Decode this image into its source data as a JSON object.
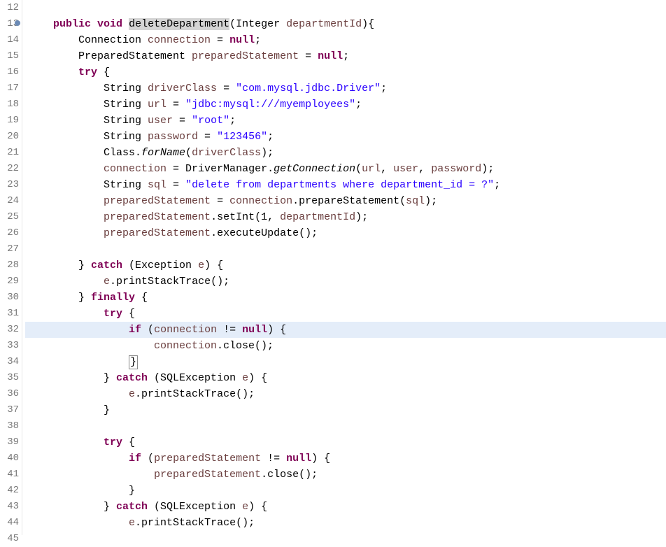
{
  "gutter": {
    "start": 12,
    "end": 45,
    "marker_line": 13
  },
  "code": {
    "highlight_line": 32,
    "lines": [
      {
        "n": 12,
        "tokens": [
          [
            "    ",
            ""
          ]
        ]
      },
      {
        "n": 13,
        "tokens": [
          [
            "    ",
            ""
          ],
          [
            "public",
            "kw"
          ],
          [
            " ",
            ""
          ],
          [
            "void",
            "kw"
          ],
          [
            " ",
            ""
          ],
          [
            "deleteDepartment",
            "sel-occ"
          ],
          [
            "(Integer ",
            ""
          ],
          [
            "departmentId",
            "var"
          ],
          [
            "){",
            ""
          ]
        ]
      },
      {
        "n": 14,
        "tokens": [
          [
            "        Connection ",
            ""
          ],
          [
            "connection",
            "var"
          ],
          [
            " = ",
            ""
          ],
          [
            "null",
            "kw"
          ],
          [
            ";",
            ""
          ]
        ]
      },
      {
        "n": 15,
        "tokens": [
          [
            "        PreparedStatement ",
            ""
          ],
          [
            "preparedStatement",
            "var"
          ],
          [
            " = ",
            ""
          ],
          [
            "null",
            "kw"
          ],
          [
            ";",
            ""
          ]
        ]
      },
      {
        "n": 16,
        "tokens": [
          [
            "        ",
            ""
          ],
          [
            "try",
            "kw"
          ],
          [
            " {",
            ""
          ]
        ]
      },
      {
        "n": 17,
        "tokens": [
          [
            "            String ",
            ""
          ],
          [
            "driverClass",
            "var"
          ],
          [
            " = ",
            ""
          ],
          [
            "\"com.mysql.jdbc.Driver\"",
            "str"
          ],
          [
            ";",
            ""
          ]
        ]
      },
      {
        "n": 18,
        "tokens": [
          [
            "            String ",
            ""
          ],
          [
            "url",
            "var"
          ],
          [
            " = ",
            ""
          ],
          [
            "\"jdbc:mysql:///myemployees\"",
            "str"
          ],
          [
            ";",
            ""
          ]
        ]
      },
      {
        "n": 19,
        "tokens": [
          [
            "            String ",
            ""
          ],
          [
            "user",
            "var"
          ],
          [
            " = ",
            ""
          ],
          [
            "\"root\"",
            "str"
          ],
          [
            ";",
            ""
          ]
        ]
      },
      {
        "n": 20,
        "tokens": [
          [
            "            String ",
            ""
          ],
          [
            "password",
            "var"
          ],
          [
            " = ",
            ""
          ],
          [
            "\"123456\"",
            "str"
          ],
          [
            ";",
            ""
          ]
        ]
      },
      {
        "n": 21,
        "tokens": [
          [
            "            Class.",
            ""
          ],
          [
            "forName",
            "mtd"
          ],
          [
            "(",
            ""
          ],
          [
            "driverClass",
            "var"
          ],
          [
            ");",
            ""
          ]
        ]
      },
      {
        "n": 22,
        "tokens": [
          [
            "            ",
            ""
          ],
          [
            "connection",
            "var"
          ],
          [
            " = DriverManager.",
            ""
          ],
          [
            "getConnection",
            "mtd"
          ],
          [
            "(",
            ""
          ],
          [
            "url",
            "var"
          ],
          [
            ", ",
            ""
          ],
          [
            "user",
            "var"
          ],
          [
            ", ",
            ""
          ],
          [
            "password",
            "var"
          ],
          [
            ");",
            ""
          ]
        ]
      },
      {
        "n": 23,
        "tokens": [
          [
            "            String ",
            ""
          ],
          [
            "sql",
            "var"
          ],
          [
            " = ",
            ""
          ],
          [
            "\"delete from departments where department_id = ?\"",
            "str"
          ],
          [
            ";",
            ""
          ]
        ]
      },
      {
        "n": 24,
        "tokens": [
          [
            "            ",
            ""
          ],
          [
            "preparedStatement",
            "var"
          ],
          [
            " = ",
            ""
          ],
          [
            "connection",
            "var"
          ],
          [
            ".prepareStatement(",
            ""
          ],
          [
            "sql",
            "var"
          ],
          [
            ");",
            ""
          ]
        ]
      },
      {
        "n": 25,
        "tokens": [
          [
            "            ",
            ""
          ],
          [
            "preparedStatement",
            "var"
          ],
          [
            ".setInt(1, ",
            ""
          ],
          [
            "departmentId",
            "var"
          ],
          [
            ");",
            ""
          ]
        ]
      },
      {
        "n": 26,
        "tokens": [
          [
            "            ",
            ""
          ],
          [
            "preparedStatement",
            "var"
          ],
          [
            ".executeUpdate();",
            ""
          ]
        ]
      },
      {
        "n": 27,
        "tokens": [
          [
            "",
            ""
          ]
        ]
      },
      {
        "n": 28,
        "tokens": [
          [
            "        } ",
            ""
          ],
          [
            "catch",
            "kw"
          ],
          [
            " (Exception ",
            ""
          ],
          [
            "e",
            "var"
          ],
          [
            ") {",
            ""
          ]
        ]
      },
      {
        "n": 29,
        "tokens": [
          [
            "            ",
            ""
          ],
          [
            "e",
            "var"
          ],
          [
            ".printStackTrace();",
            ""
          ]
        ]
      },
      {
        "n": 30,
        "tokens": [
          [
            "        } ",
            ""
          ],
          [
            "finally",
            "kw"
          ],
          [
            " {",
            ""
          ]
        ]
      },
      {
        "n": 31,
        "tokens": [
          [
            "            ",
            ""
          ],
          [
            "try",
            "kw"
          ],
          [
            " {",
            ""
          ]
        ]
      },
      {
        "n": 32,
        "tokens": [
          [
            "                ",
            ""
          ],
          [
            "if",
            "kw"
          ],
          [
            " (",
            ""
          ],
          [
            "connection",
            "var"
          ],
          [
            " != ",
            ""
          ],
          [
            "null",
            "kw"
          ],
          [
            ") {",
            ""
          ]
        ]
      },
      {
        "n": 33,
        "tokens": [
          [
            "                    ",
            ""
          ],
          [
            "connection",
            "var"
          ],
          [
            ".close();",
            ""
          ]
        ]
      },
      {
        "n": 34,
        "tokens": [
          [
            "                ",
            ""
          ],
          [
            "}",
            "box"
          ]
        ]
      },
      {
        "n": 35,
        "tokens": [
          [
            "            } ",
            ""
          ],
          [
            "catch",
            "kw"
          ],
          [
            " (SQLException ",
            ""
          ],
          [
            "e",
            "var"
          ],
          [
            ") {",
            ""
          ]
        ]
      },
      {
        "n": 36,
        "tokens": [
          [
            "                ",
            ""
          ],
          [
            "e",
            "var"
          ],
          [
            ".printStackTrace();",
            ""
          ]
        ]
      },
      {
        "n": 37,
        "tokens": [
          [
            "            }",
            ""
          ]
        ]
      },
      {
        "n": 38,
        "tokens": [
          [
            "",
            ""
          ]
        ]
      },
      {
        "n": 39,
        "tokens": [
          [
            "            ",
            ""
          ],
          [
            "try",
            "kw"
          ],
          [
            " {",
            ""
          ]
        ]
      },
      {
        "n": 40,
        "tokens": [
          [
            "                ",
            ""
          ],
          [
            "if",
            "kw"
          ],
          [
            " (",
            ""
          ],
          [
            "preparedStatement",
            "var"
          ],
          [
            " != ",
            ""
          ],
          [
            "null",
            "kw"
          ],
          [
            ") {",
            ""
          ]
        ]
      },
      {
        "n": 41,
        "tokens": [
          [
            "                    ",
            ""
          ],
          [
            "preparedStatement",
            "var"
          ],
          [
            ".close();",
            ""
          ]
        ]
      },
      {
        "n": 42,
        "tokens": [
          [
            "                }",
            ""
          ]
        ]
      },
      {
        "n": 43,
        "tokens": [
          [
            "            } ",
            ""
          ],
          [
            "catch",
            "kw"
          ],
          [
            " (SQLException ",
            ""
          ],
          [
            "e",
            "var"
          ],
          [
            ") {",
            ""
          ]
        ]
      },
      {
        "n": 44,
        "tokens": [
          [
            "                ",
            ""
          ],
          [
            "e",
            "var"
          ],
          [
            ".printStackTrace();",
            ""
          ]
        ]
      },
      {
        "n": 45,
        "tokens": [
          [
            "            ",
            ""
          ]
        ]
      }
    ]
  }
}
